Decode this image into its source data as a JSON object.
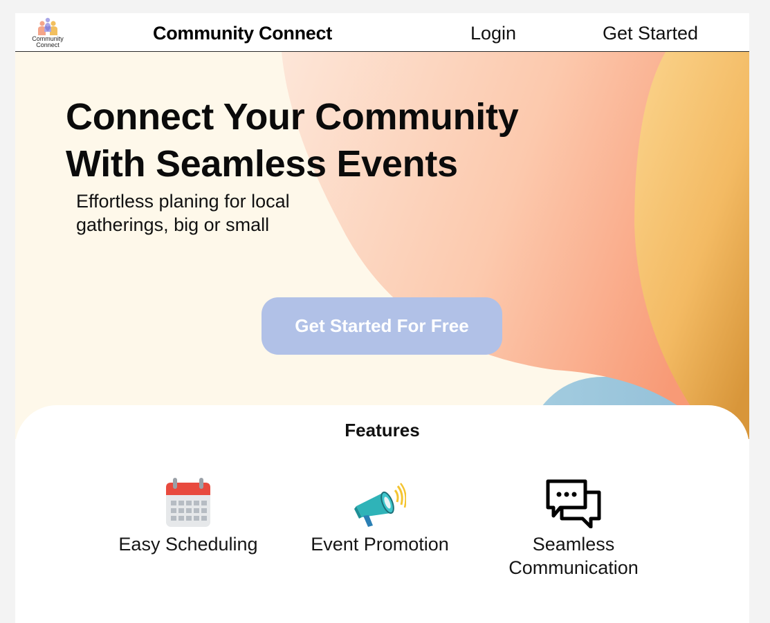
{
  "navbar": {
    "logo_text": "Community Connect",
    "brand": "Community Connect",
    "login": "Login",
    "get_started": "Get Started"
  },
  "hero": {
    "title_line1": "Connect Your Community",
    "title_line2": "With Seamless Events",
    "subtitle_line1": "Effortless planing for local",
    "subtitle_line2": "gatherings, big or small",
    "cta_label": "Get Started For Free"
  },
  "features": {
    "title": "Features",
    "items": [
      {
        "label": "Easy Scheduling",
        "icon": "calendar-icon"
      },
      {
        "label": "Event Promotion",
        "icon": "megaphone-icon"
      },
      {
        "label_line1": "Seamless",
        "label_line2": "Communication",
        "icon": "chat-bubbles-icon"
      }
    ]
  },
  "colors": {
    "page_bg": "#f3f3f3",
    "hero_bg": "#fef8ea",
    "peach": "#fcd0b8",
    "orange": "#f8a27a",
    "gold": "#f6b54e",
    "blue_accent": "#9cc4dc",
    "cta_bg": "#b1c1e7",
    "text": "#111111"
  }
}
